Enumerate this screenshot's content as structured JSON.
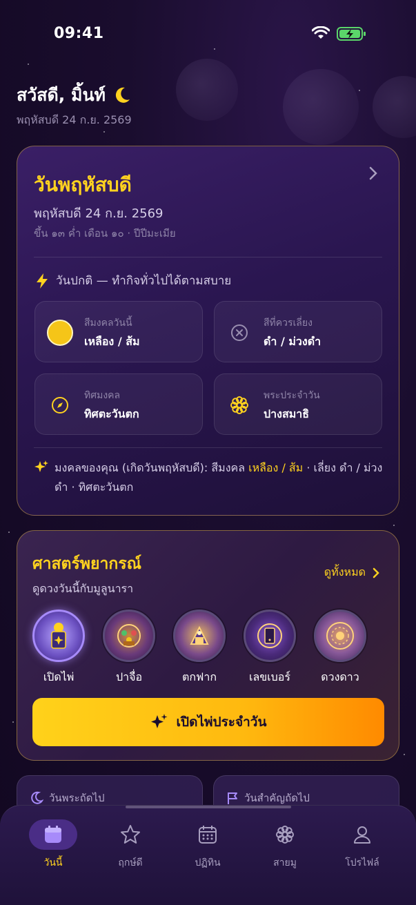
{
  "status_bar": {
    "time": "09:41"
  },
  "header": {
    "greeting": "สวัสดี, มิ้นท์",
    "date": "พฤหัสบดี 24 ก.ย. 2569"
  },
  "day_card": {
    "title": "วันพฤหัสบดี",
    "date": "พฤหัสบดี 24 ก.ย. 2569",
    "lunar": "ขึ้น ๑๓ ค่ำ เดือน ๑๐ · ปีปีมะเมีย",
    "note": "วันปกติ — ทำกิจทั่วไปได้ตามสบาย",
    "tiles": [
      {
        "label": "สีมงคลวันนี้",
        "value": "เหลือง / ส้ม",
        "icon": "yellow-circle-icon",
        "color": "#f5c518"
      },
      {
        "label": "สีที่ควรเลี่ยง",
        "value": "ดำ / ม่วงดำ",
        "icon": "x-circle-icon"
      },
      {
        "label": "ทิศมงคล",
        "value": "ทิศตะวันตก",
        "icon": "compass-icon"
      },
      {
        "label": "พระประจำวัน",
        "value": "ปางสมาธิ",
        "icon": "lotus-icon"
      }
    ],
    "lucky": {
      "prefix": "มงคลของคุณ (เกิดวันพฤหัสบดี): สีมงคล",
      "highlight": "เหลือง / ส้ม",
      "suffix": "· เลี่ยง ดำ / ม่วงดำ · ทิศตะวันตก"
    }
  },
  "fortune_card": {
    "title": "ศาสตร์พยากรณ์",
    "subtitle": "ดูดวงวันนี้กับมูลูนารา",
    "see_all": "ดูทั้งหมด",
    "tools": [
      {
        "label": "เปิดไพ่",
        "icon": "tarot-icon"
      },
      {
        "label": "ปาจื่อ",
        "icon": "bazi-icon"
      },
      {
        "label": "ตกฟาก",
        "icon": "birth-chart-icon"
      },
      {
        "label": "เลขเบอร์",
        "icon": "numerology-icon"
      },
      {
        "label": "ดวงดาว",
        "icon": "zodiac-icon"
      }
    ],
    "cta": "เปิดไพ่ประจำวัน"
  },
  "mini_cards": [
    {
      "label": "วันพระถัดไป",
      "icon": "moon-icon"
    },
    {
      "label": "วันสำคัญถัดไป",
      "icon": "flag-icon"
    }
  ],
  "tabs": [
    {
      "label": "วันนี้",
      "icon": "calendar-icon",
      "active": true
    },
    {
      "label": "ฤกษ์ดี",
      "icon": "star-icon"
    },
    {
      "label": "ปฏิทิน",
      "icon": "calendar-grid-icon"
    },
    {
      "label": "สายมู",
      "icon": "lotus-icon"
    },
    {
      "label": "โปรไฟล์",
      "icon": "user-icon"
    }
  ],
  "colors": {
    "accent": "#ffd21f",
    "background": "#1a0d2e",
    "card": "#2a1650",
    "active_tab": "#4a2d86"
  }
}
